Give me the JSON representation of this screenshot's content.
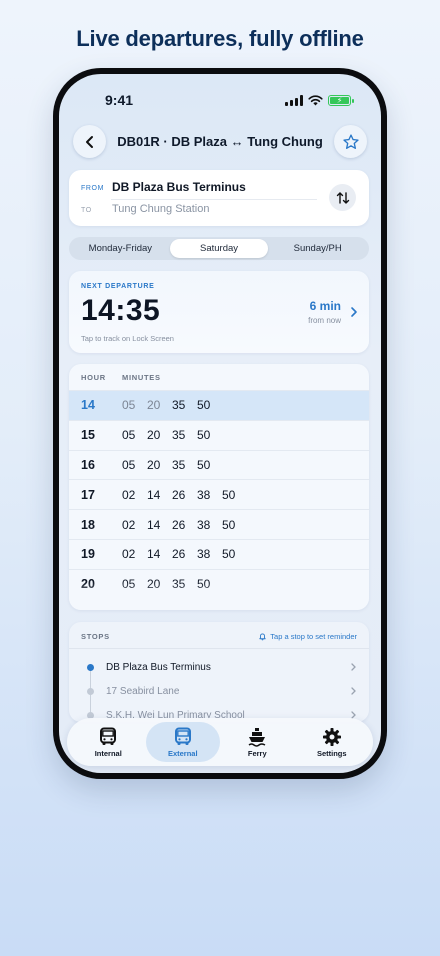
{
  "headline": "Live departures, fully offline",
  "status_bar": {
    "time": "9:41"
  },
  "header": {
    "title": "DB01R · DB Plaza ↔ Tung Chung"
  },
  "route": {
    "from_label": "FROM",
    "from_value": "DB Plaza Bus Terminus",
    "to_label": "TO",
    "to_value": "Tung Chung Station"
  },
  "day_tabs": [
    {
      "label": "Monday-Friday",
      "active": false
    },
    {
      "label": "Saturday",
      "active": true
    },
    {
      "label": "Sunday/PH",
      "active": false
    }
  ],
  "next_departure": {
    "label": "NEXT DEPARTURE",
    "time": "14:35",
    "hint": "Tap to track on Lock Screen",
    "countdown": "6 min",
    "countdown_suffix": "from now"
  },
  "timetable": {
    "hour_header": "HOUR",
    "minutes_header": "MINUTES",
    "rows": [
      {
        "hour": "14",
        "minutes": [
          "05",
          "20",
          "35",
          "50"
        ],
        "current": true,
        "past_count": 2
      },
      {
        "hour": "15",
        "minutes": [
          "05",
          "20",
          "35",
          "50"
        ],
        "current": false,
        "past_count": 0
      },
      {
        "hour": "16",
        "minutes": [
          "05",
          "20",
          "35",
          "50"
        ],
        "current": false,
        "past_count": 0
      },
      {
        "hour": "17",
        "minutes": [
          "02",
          "14",
          "26",
          "38",
          "50"
        ],
        "current": false,
        "past_count": 0
      },
      {
        "hour": "18",
        "minutes": [
          "02",
          "14",
          "26",
          "38",
          "50"
        ],
        "current": false,
        "past_count": 0
      },
      {
        "hour": "19",
        "minutes": [
          "02",
          "14",
          "26",
          "38",
          "50"
        ],
        "current": false,
        "past_count": 0
      },
      {
        "hour": "20",
        "minutes": [
          "05",
          "20",
          "35",
          "50"
        ],
        "current": false,
        "past_count": 0
      }
    ]
  },
  "stops": {
    "header": "STOPS",
    "reminder_hint": "Tap a stop to set reminder",
    "items": [
      {
        "name": "DB Plaza Bus Terminus",
        "active": true
      },
      {
        "name": "17 Seabird Lane",
        "active": false
      },
      {
        "name": "S.K.H. Wei Lun Primary School",
        "active": false
      }
    ]
  },
  "tabbar": [
    {
      "label": "Internal",
      "icon": "bus-icon",
      "active": false
    },
    {
      "label": "External",
      "icon": "bus-icon",
      "active": true
    },
    {
      "label": "Ferry",
      "icon": "ferry-icon",
      "active": false
    },
    {
      "label": "Settings",
      "icon": "gear-icon",
      "active": false
    }
  ],
  "colors": {
    "accent": "#2a78c8",
    "battery": "#35c759"
  }
}
